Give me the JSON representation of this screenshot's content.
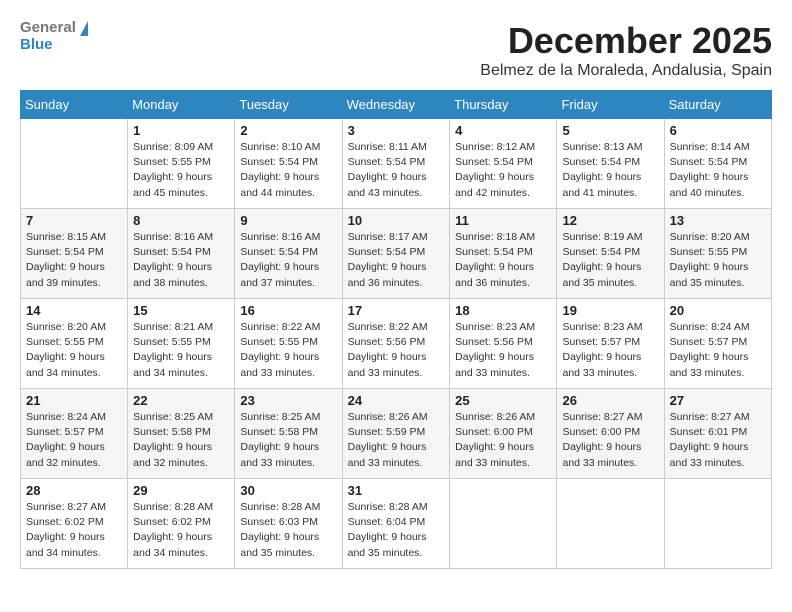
{
  "header": {
    "logo_general": "General",
    "logo_blue": "Blue",
    "month_title": "December 2025",
    "location": "Belmez de la Moraleda, Andalusia, Spain"
  },
  "days_of_week": [
    "Sunday",
    "Monday",
    "Tuesday",
    "Wednesday",
    "Thursday",
    "Friday",
    "Saturday"
  ],
  "weeks": [
    [
      {
        "day": "",
        "info": ""
      },
      {
        "day": "1",
        "info": "Sunrise: 8:09 AM\nSunset: 5:55 PM\nDaylight: 9 hours\nand 45 minutes."
      },
      {
        "day": "2",
        "info": "Sunrise: 8:10 AM\nSunset: 5:54 PM\nDaylight: 9 hours\nand 44 minutes."
      },
      {
        "day": "3",
        "info": "Sunrise: 8:11 AM\nSunset: 5:54 PM\nDaylight: 9 hours\nand 43 minutes."
      },
      {
        "day": "4",
        "info": "Sunrise: 8:12 AM\nSunset: 5:54 PM\nDaylight: 9 hours\nand 42 minutes."
      },
      {
        "day": "5",
        "info": "Sunrise: 8:13 AM\nSunset: 5:54 PM\nDaylight: 9 hours\nand 41 minutes."
      },
      {
        "day": "6",
        "info": "Sunrise: 8:14 AM\nSunset: 5:54 PM\nDaylight: 9 hours\nand 40 minutes."
      }
    ],
    [
      {
        "day": "7",
        "info": "Sunrise: 8:15 AM\nSunset: 5:54 PM\nDaylight: 9 hours\nand 39 minutes."
      },
      {
        "day": "8",
        "info": "Sunrise: 8:16 AM\nSunset: 5:54 PM\nDaylight: 9 hours\nand 38 minutes."
      },
      {
        "day": "9",
        "info": "Sunrise: 8:16 AM\nSunset: 5:54 PM\nDaylight: 9 hours\nand 37 minutes."
      },
      {
        "day": "10",
        "info": "Sunrise: 8:17 AM\nSunset: 5:54 PM\nDaylight: 9 hours\nand 36 minutes."
      },
      {
        "day": "11",
        "info": "Sunrise: 8:18 AM\nSunset: 5:54 PM\nDaylight: 9 hours\nand 36 minutes."
      },
      {
        "day": "12",
        "info": "Sunrise: 8:19 AM\nSunset: 5:54 PM\nDaylight: 9 hours\nand 35 minutes."
      },
      {
        "day": "13",
        "info": "Sunrise: 8:20 AM\nSunset: 5:55 PM\nDaylight: 9 hours\nand 35 minutes."
      }
    ],
    [
      {
        "day": "14",
        "info": "Sunrise: 8:20 AM\nSunset: 5:55 PM\nDaylight: 9 hours\nand 34 minutes."
      },
      {
        "day": "15",
        "info": "Sunrise: 8:21 AM\nSunset: 5:55 PM\nDaylight: 9 hours\nand 34 minutes."
      },
      {
        "day": "16",
        "info": "Sunrise: 8:22 AM\nSunset: 5:55 PM\nDaylight: 9 hours\nand 33 minutes."
      },
      {
        "day": "17",
        "info": "Sunrise: 8:22 AM\nSunset: 5:56 PM\nDaylight: 9 hours\nand 33 minutes."
      },
      {
        "day": "18",
        "info": "Sunrise: 8:23 AM\nSunset: 5:56 PM\nDaylight: 9 hours\nand 33 minutes."
      },
      {
        "day": "19",
        "info": "Sunrise: 8:23 AM\nSunset: 5:57 PM\nDaylight: 9 hours\nand 33 minutes."
      },
      {
        "day": "20",
        "info": "Sunrise: 8:24 AM\nSunset: 5:57 PM\nDaylight: 9 hours\nand 33 minutes."
      }
    ],
    [
      {
        "day": "21",
        "info": "Sunrise: 8:24 AM\nSunset: 5:57 PM\nDaylight: 9 hours\nand 32 minutes."
      },
      {
        "day": "22",
        "info": "Sunrise: 8:25 AM\nSunset: 5:58 PM\nDaylight: 9 hours\nand 32 minutes."
      },
      {
        "day": "23",
        "info": "Sunrise: 8:25 AM\nSunset: 5:58 PM\nDaylight: 9 hours\nand 33 minutes."
      },
      {
        "day": "24",
        "info": "Sunrise: 8:26 AM\nSunset: 5:59 PM\nDaylight: 9 hours\nand 33 minutes."
      },
      {
        "day": "25",
        "info": "Sunrise: 8:26 AM\nSunset: 6:00 PM\nDaylight: 9 hours\nand 33 minutes."
      },
      {
        "day": "26",
        "info": "Sunrise: 8:27 AM\nSunset: 6:00 PM\nDaylight: 9 hours\nand 33 minutes."
      },
      {
        "day": "27",
        "info": "Sunrise: 8:27 AM\nSunset: 6:01 PM\nDaylight: 9 hours\nand 33 minutes."
      }
    ],
    [
      {
        "day": "28",
        "info": "Sunrise: 8:27 AM\nSunset: 6:02 PM\nDaylight: 9 hours\nand 34 minutes."
      },
      {
        "day": "29",
        "info": "Sunrise: 8:28 AM\nSunset: 6:02 PM\nDaylight: 9 hours\nand 34 minutes."
      },
      {
        "day": "30",
        "info": "Sunrise: 8:28 AM\nSunset: 6:03 PM\nDaylight: 9 hours\nand 35 minutes."
      },
      {
        "day": "31",
        "info": "Sunrise: 8:28 AM\nSunset: 6:04 PM\nDaylight: 9 hours\nand 35 minutes."
      },
      {
        "day": "",
        "info": ""
      },
      {
        "day": "",
        "info": ""
      },
      {
        "day": "",
        "info": ""
      }
    ]
  ]
}
